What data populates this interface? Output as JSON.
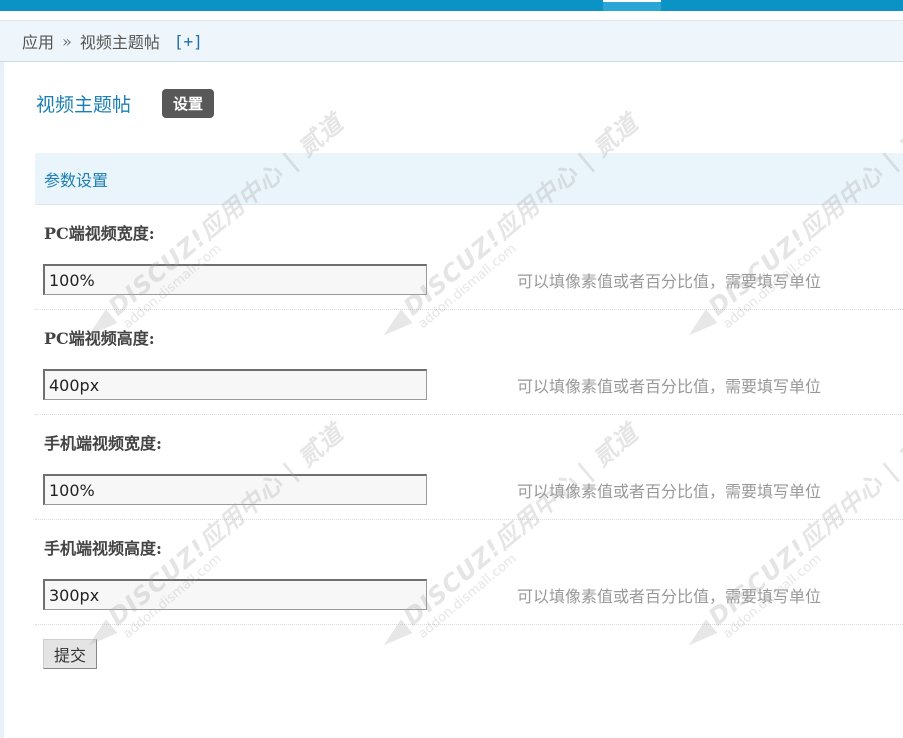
{
  "breadcrumb": {
    "app": "应用",
    "separator": "»",
    "current": "视频主题帖",
    "add": "[+]"
  },
  "page": {
    "title": "视频主题帖",
    "tab_settings": "设置"
  },
  "section": {
    "title": "参数设置"
  },
  "fields": [
    {
      "label": "PC端视频宽度:",
      "value": "100%",
      "tip": "可以填像素值或者百分比值，需要填写单位"
    },
    {
      "label": "PC端视频高度:",
      "value": "400px",
      "tip": "可以填像素值或者百分比值，需要填写单位"
    },
    {
      "label": "手机端视频宽度:",
      "value": "100%",
      "tip": "可以填像素值或者百分比值，需要填写单位"
    },
    {
      "label": "手机端视频高度:",
      "value": "300px",
      "tip": "可以填像素值或者百分比值，需要填写单位"
    }
  ],
  "submit_label": "提交",
  "watermark": {
    "brand": "DISCUZ!应用中心 | 贰道",
    "domain": "addon.dismall.com"
  },
  "colors": {
    "topbar": "#0b93c5",
    "accent_text": "#1b7fb3",
    "section_bg": "#eaf4fb",
    "tab_bg": "#585858"
  }
}
